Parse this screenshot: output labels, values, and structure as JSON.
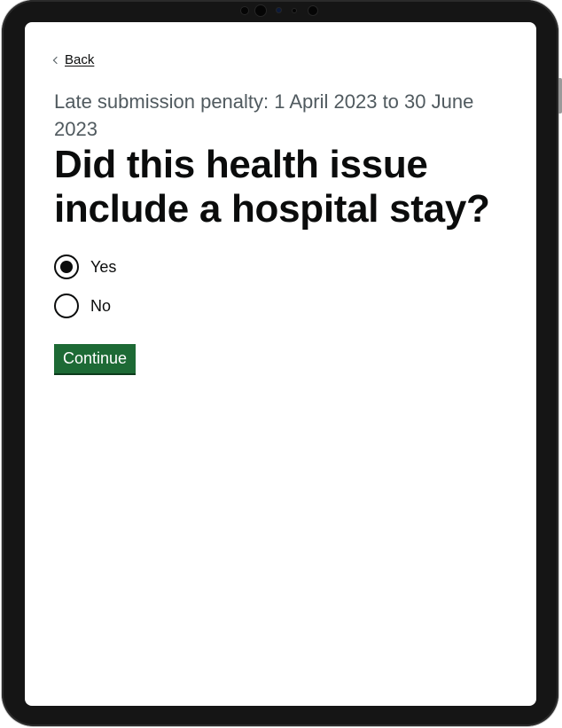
{
  "back_link": {
    "label": "Back",
    "icon": "chevron-left-icon"
  },
  "caption": "Late submission penalty: 1 April 2023 to 30 June 2023",
  "heading": "Did this health issue include a hospital stay?",
  "radios": {
    "options": [
      {
        "label": "Yes",
        "checked": true
      },
      {
        "label": "No",
        "checked": false
      }
    ]
  },
  "continue_button": {
    "label": "Continue"
  },
  "colors": {
    "button_green": "#1d6a35",
    "text": "#0b0c0c",
    "caption_grey": "#505a5f",
    "bezel": "#151515"
  }
}
